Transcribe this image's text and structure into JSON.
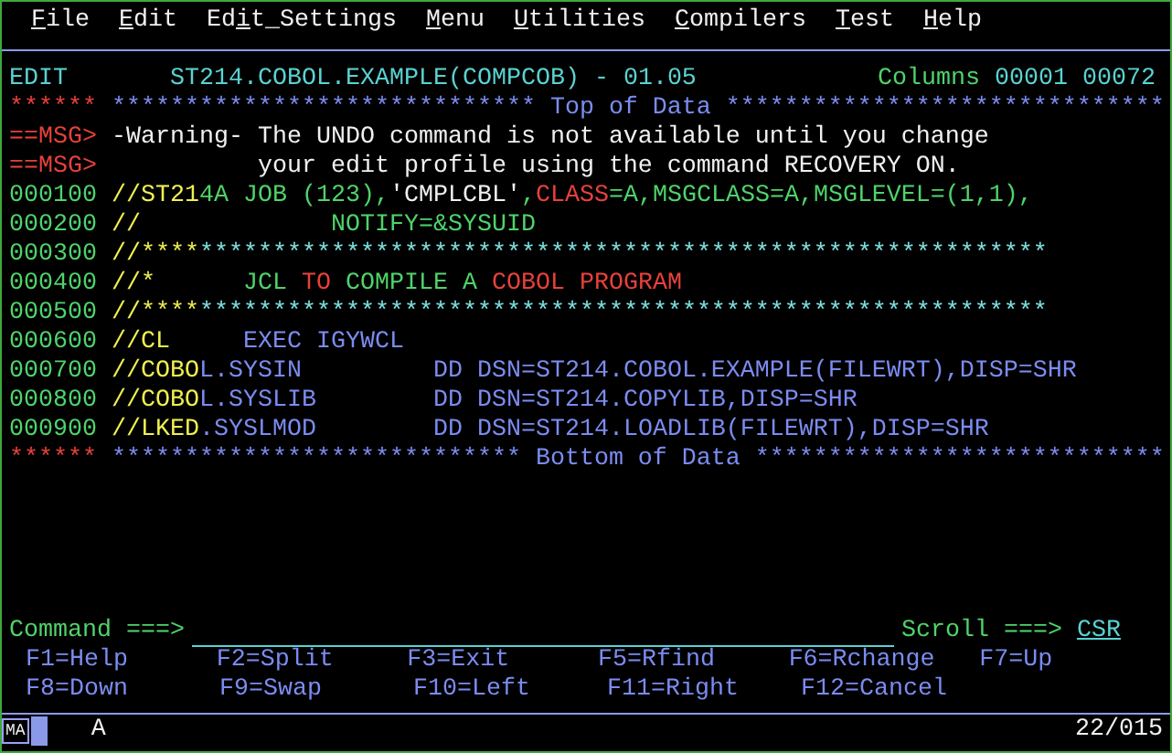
{
  "menu": [
    {
      "key": "F",
      "post": "ile"
    },
    {
      "key": "E",
      "post": "dit"
    },
    {
      "pre": "Ed",
      "key": "i",
      "post": "t_Settings"
    },
    {
      "key": "M",
      "post": "enu"
    },
    {
      "key": "U",
      "post": "tilities"
    },
    {
      "key": "C",
      "post": "ompilers"
    },
    {
      "key": "T",
      "post": "est"
    },
    {
      "key": "H",
      "post": "elp"
    }
  ],
  "header": {
    "mode": "EDIT",
    "dataset": "ST214.COBOL.EXAMPLE(COMPCOB) - 01.05",
    "columns_label": "Columns",
    "columns": "00001 00072"
  },
  "lines": [
    {
      "kind": "marker",
      "prefix": "******",
      "segments": [
        {
          "text": "***************************** Top of Data ******************************",
          "color": "#7b8cf0"
        }
      ]
    },
    {
      "kind": "message",
      "prefix": "==MSG>",
      "segments": [
        {
          "text": "-Warning- The UNDO command is not available until you change",
          "color": "#f0f0f0"
        }
      ]
    },
    {
      "kind": "message",
      "prefix": "==MSG>",
      "segments": [
        {
          "text": "          your edit profile using the command RECOVERY ON.",
          "color": "#f0f0f0"
        }
      ]
    },
    {
      "kind": "data",
      "prefix": "000100",
      "segments": [
        {
          "text": "//ST21",
          "color": "#f0f050"
        },
        {
          "text": "4A JOB (123),",
          "color": "#4fd36a"
        },
        {
          "text": "'CMPLCBL'",
          "color": "#f0f0f0"
        },
        {
          "text": ",",
          "color": "#4fd36a"
        },
        {
          "text": "CLASS",
          "color": "#e8413c"
        },
        {
          "text": "=A,MSGCLASS=A,MSGLEVEL=(1,1),",
          "color": "#4fd36a"
        }
      ]
    },
    {
      "kind": "data",
      "prefix": "000200",
      "segments": [
        {
          "text": "//",
          "color": "#f0f050"
        },
        {
          "text": "             NOTIFY=&SYSUID",
          "color": "#4fd36a"
        }
      ]
    },
    {
      "kind": "data",
      "prefix": "000300",
      "segments": [
        {
          "text": "//****",
          "color": "#f0f050"
        },
        {
          "text": "**********************************************************",
          "color": "#7ee0e0"
        }
      ]
    },
    {
      "kind": "data",
      "prefix": "000400",
      "segments": [
        {
          "text": "//*",
          "color": "#f0f050"
        },
        {
          "text": "      JCL ",
          "color": "#4fd36a"
        },
        {
          "text": "TO",
          "color": "#e8413c"
        },
        {
          "text": " COMPILE A ",
          "color": "#4fd36a"
        },
        {
          "text": "COBOL PROGRAM",
          "color": "#e8413c"
        }
      ]
    },
    {
      "kind": "data",
      "prefix": "000500",
      "segments": [
        {
          "text": "//****",
          "color": "#f0f050"
        },
        {
          "text": "**********************************************************",
          "color": "#7ee0e0"
        }
      ]
    },
    {
      "kind": "data",
      "prefix": "000600",
      "segments": [
        {
          "text": "//CL",
          "color": "#f0f050"
        },
        {
          "text": "     EXEC IGYWCL",
          "color": "#7b8cf0"
        }
      ]
    },
    {
      "kind": "data",
      "prefix": "000700",
      "segments": [
        {
          "text": "//COBO",
          "color": "#f0f050"
        },
        {
          "text": "L.SYSIN         DD DSN=ST214.COBOL.EXAMPLE(FILEWRT),DISP=SHR",
          "color": "#7b8cf0"
        }
      ]
    },
    {
      "kind": "data",
      "prefix": "000800",
      "segments": [
        {
          "text": "//COBO",
          "color": "#f0f050"
        },
        {
          "text": "L.SYSLIB        DD DSN=ST214.COPYLIB,DISP=SHR",
          "color": "#7b8cf0"
        }
      ]
    },
    {
      "kind": "data",
      "prefix": "000900",
      "segments": [
        {
          "text": "//LKED",
          "color": "#f0f050"
        },
        {
          "text": ".SYSLMOD        DD DSN=ST214.LOADLIB(FILEWRT),DISP=SHR",
          "color": "#7b8cf0"
        }
      ]
    },
    {
      "kind": "marker",
      "prefix": "******",
      "segments": [
        {
          "text": "**************************** Bottom of Data ****************************",
          "color": "#7b8cf0"
        }
      ]
    }
  ],
  "command": {
    "label": "Command ===>",
    "scroll_label": "Scroll ===>",
    "scroll_value": "CSR"
  },
  "function_keys": [
    [
      "F1=Help",
      "F2=Split",
      "F3=Exit",
      "F5=Rfind",
      "F6=Rchange",
      "F7=Up"
    ],
    [
      "F8=Down",
      "F9=Swap",
      "F10=Left",
      "F11=Right",
      "F12=Cancel"
    ]
  ],
  "status": {
    "indicator": "MA",
    "mode": "A",
    "position": "22/015"
  }
}
